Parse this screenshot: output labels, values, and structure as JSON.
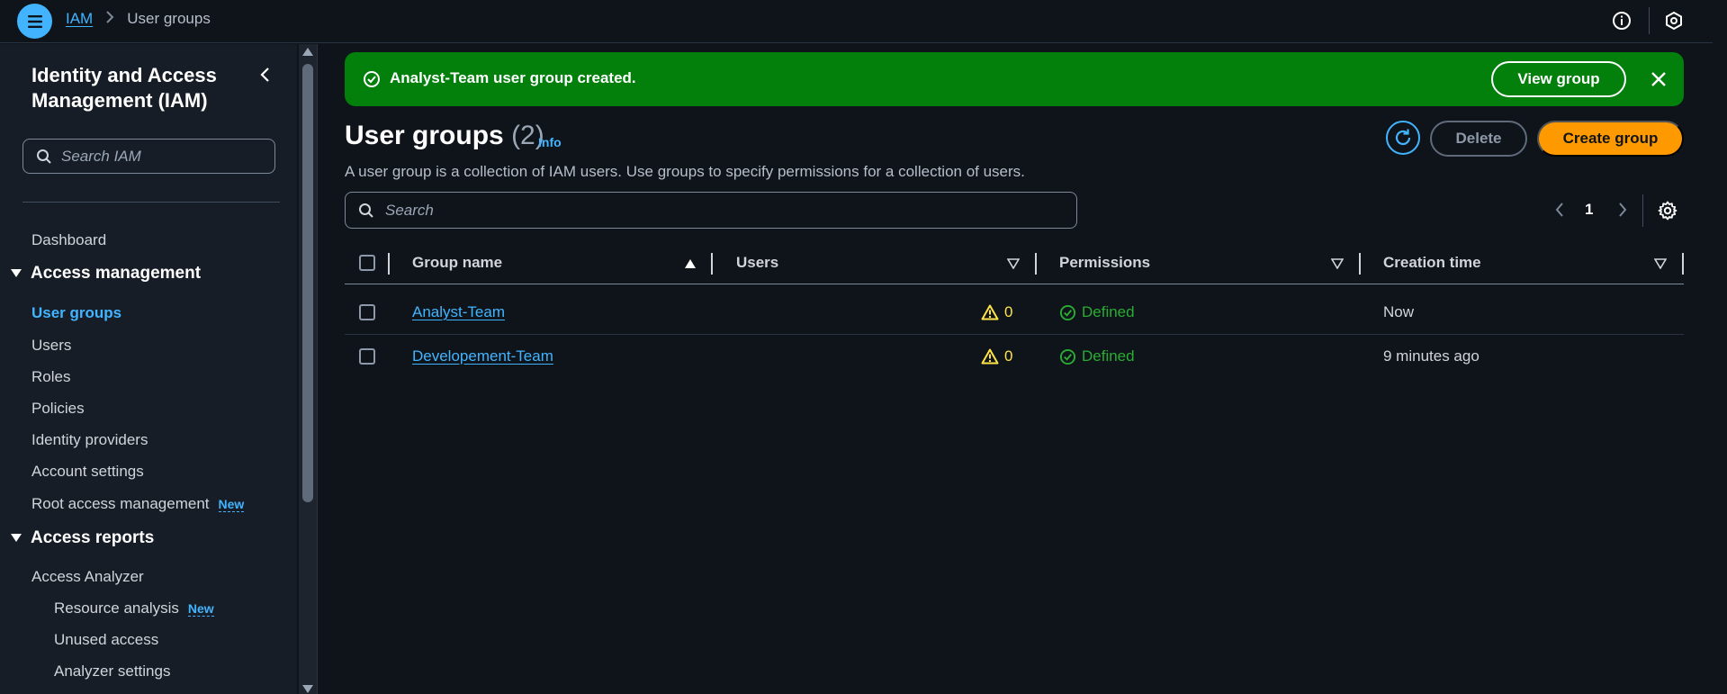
{
  "topbar": {
    "breadcrumb_root": "IAM",
    "breadcrumb_current": "User groups"
  },
  "sidebar": {
    "title": "Identity and Access Management (IAM)",
    "search_placeholder": "Search IAM",
    "dashboard": "Dashboard",
    "access_management": {
      "label": "Access management",
      "items": [
        "User groups",
        "Users",
        "Roles",
        "Policies",
        "Identity providers",
        "Account settings",
        "Root access management"
      ],
      "new_badge": "New"
    },
    "access_reports": {
      "label": "Access reports",
      "analyzer": "Access Analyzer",
      "sub_items": [
        "Resource analysis",
        "Unused access",
        "Analyzer settings"
      ],
      "new_badge": "New"
    }
  },
  "flash": {
    "message": "Analyst-Team user group created.",
    "action_label": "View group",
    "color": "#037f0c"
  },
  "header": {
    "title": "User groups",
    "count": "(2)",
    "info": "Info",
    "description": "A user group is a collection of IAM users. Use groups to specify permissions for a collection of users.",
    "delete_label": "Delete",
    "create_label": "Create group"
  },
  "table": {
    "search_placeholder": "Search",
    "page": "1",
    "columns": [
      "Group name",
      "Users",
      "Permissions",
      "Creation time"
    ],
    "rows": [
      {
        "name": "Analyst-Team",
        "users": "0",
        "permissions": "Defined",
        "created": "Now"
      },
      {
        "name": "Developement-Team",
        "users": "0",
        "permissions": "Defined",
        "created": "9 minutes ago"
      }
    ]
  },
  "colors": {
    "accent": "#42b4ff",
    "primary_button": "#ff9900",
    "success": "#29ad32",
    "warning": "#ffe347"
  }
}
